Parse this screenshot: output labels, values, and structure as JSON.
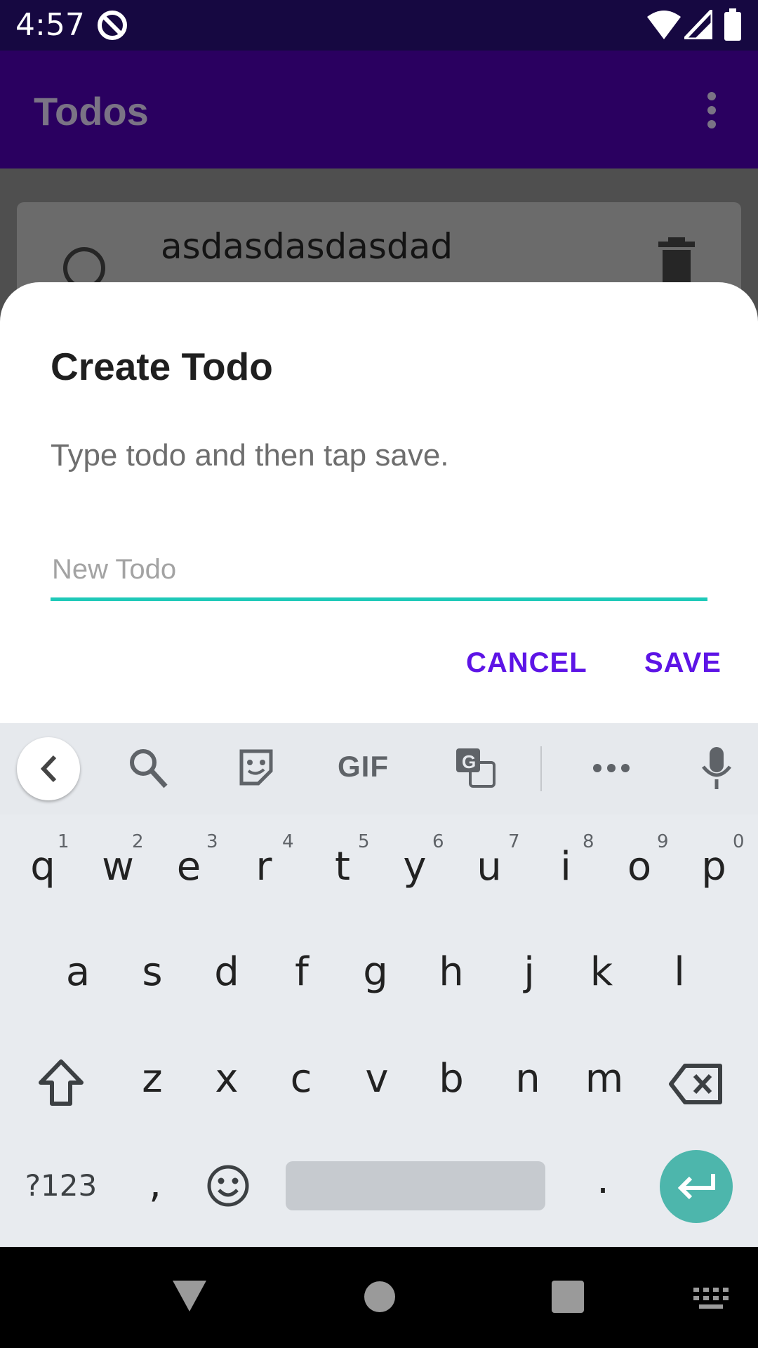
{
  "status_bar": {
    "time": "4:57"
  },
  "app_bar": {
    "title": "Todos"
  },
  "todo_list": {
    "items": [
      {
        "text": "asdasdasdasdad"
      }
    ]
  },
  "dialog": {
    "title": "Create Todo",
    "message": "Type todo and then tap save.",
    "input_placeholder": "New Todo",
    "input_value": "",
    "cancel_label": "CANCEL",
    "save_label": "SAVE",
    "accent_color": "#5d14e6",
    "underline_color": "#1ec9b8"
  },
  "keyboard": {
    "suggestions": {
      "gif_label": "GIF"
    },
    "row1": [
      "q",
      "w",
      "e",
      "r",
      "t",
      "y",
      "u",
      "i",
      "o",
      "p"
    ],
    "row1_hints": [
      "1",
      "2",
      "3",
      "4",
      "5",
      "6",
      "7",
      "8",
      "9",
      "0"
    ],
    "row2": [
      "a",
      "s",
      "d",
      "f",
      "g",
      "h",
      "j",
      "k",
      "l"
    ],
    "row3": [
      "z",
      "x",
      "c",
      "v",
      "b",
      "n",
      "m"
    ],
    "bottom": {
      "symbols_label": "?123",
      "comma": ",",
      "period": "."
    }
  }
}
